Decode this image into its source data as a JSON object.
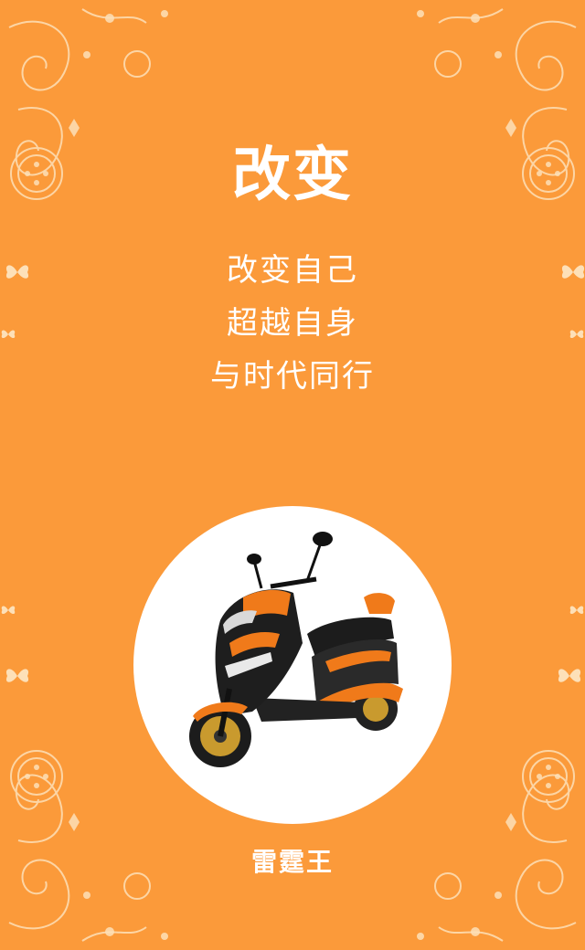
{
  "headline": "改变",
  "lines": [
    "改变自己",
    "超越自身",
    "与时代同行"
  ],
  "brand": "雷霆王",
  "colors": {
    "background": "#fb9a3a",
    "ornament": "#fde0b8",
    "text": "#ffffff",
    "circle": "#ffffff"
  },
  "icons": {
    "ornament": "floral-swirl-icon",
    "butterfly": "butterfly-icon",
    "product": "electric-scooter-image"
  }
}
